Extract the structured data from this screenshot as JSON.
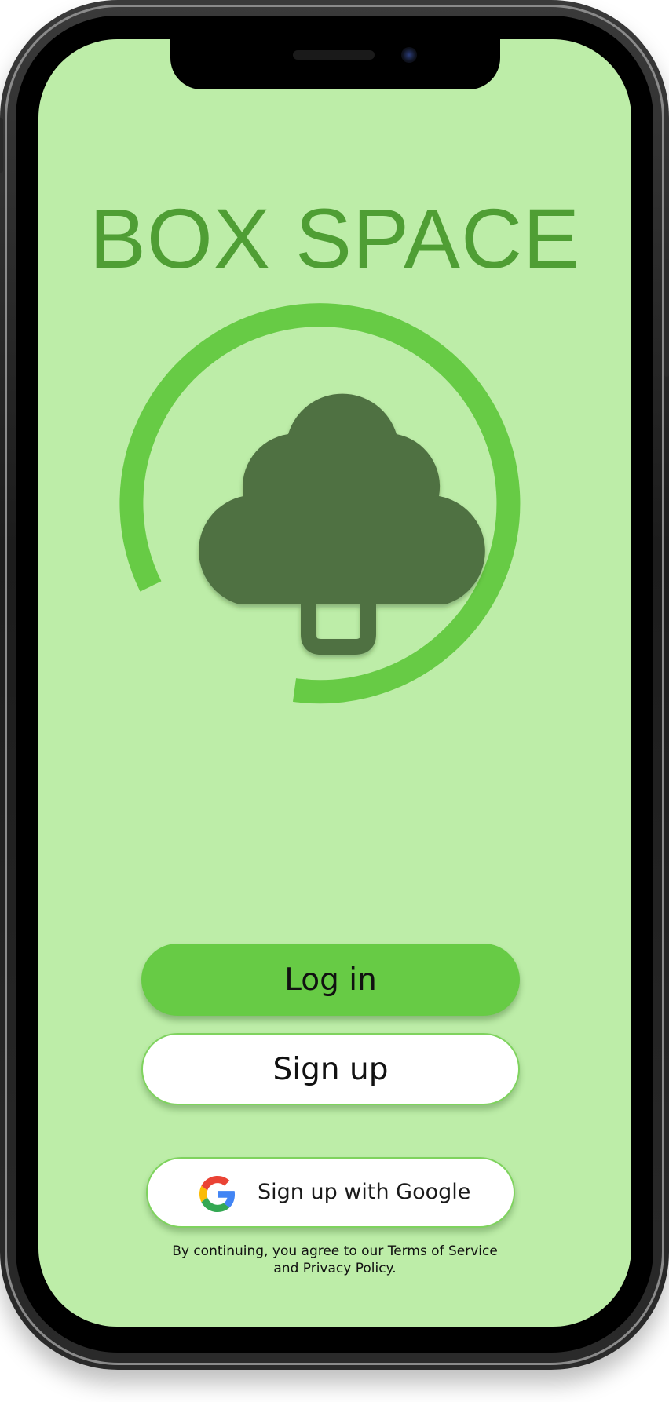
{
  "app": {
    "title": "BOX SPACE"
  },
  "actions": {
    "login_label": "Log in",
    "signup_label": "Sign up",
    "google_label": "Sign up with Google"
  },
  "legal": {
    "line1": "By continuing, you agree to our Terms of Service",
    "line2": "and Privacy Policy."
  },
  "icons": {
    "logo": "tree-icon",
    "google": "google-icon"
  },
  "colors": {
    "background": "#bdeda8",
    "title": "#4f9e34",
    "ring": "#67cb45",
    "tree": "#4f7142",
    "primary_button": "#67cb45",
    "secondary_button": "#ffffff",
    "button_border": "#7fd35e"
  }
}
